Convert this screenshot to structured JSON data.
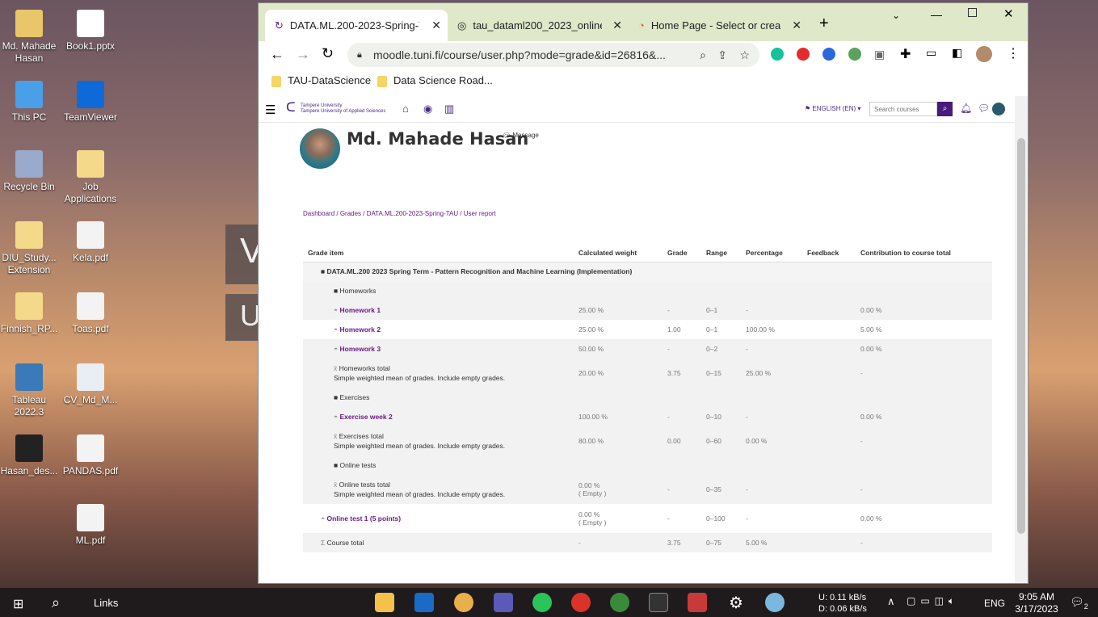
{
  "desktop_icons": [
    {
      "label": "Md. Mahade Hasan",
      "icon": "user-folder-icon"
    },
    {
      "label": "Book1.pptx",
      "icon": "pptx-icon"
    },
    {
      "label": "This PC",
      "icon": "pc-icon"
    },
    {
      "label": "TeamViewer",
      "icon": "teamviewer-icon"
    },
    {
      "label": "Recycle Bin",
      "icon": "recycle-icon"
    },
    {
      "label": "Job Applications",
      "icon": "folder-icon"
    },
    {
      "label": "DIU_Study... Extension",
      "icon": "folder-icon"
    },
    {
      "label": "Kela.pdf",
      "icon": "pdf-icon"
    },
    {
      "label": "Finnish_RP...",
      "icon": "folder-icon"
    },
    {
      "label": "Toas.pdf",
      "icon": "pdf-icon"
    },
    {
      "label": "Tableau 2022.3",
      "icon": "tableau-icon"
    },
    {
      "label": "CV_Md_M...",
      "icon": "doc-icon"
    },
    {
      "label": "Hasan_des...",
      "icon": "image-icon"
    },
    {
      "label": "PANDAS.pdf",
      "icon": "pdf-icon"
    },
    {
      "label": "ML.pdf",
      "icon": "pdf-icon"
    }
  ],
  "browser": {
    "tabs": [
      {
        "title": "DATA.ML.200-2023-Spring-TAU"
      },
      {
        "title": "tau_dataml200_2023_online1.g"
      },
      {
        "title": "Home Page - Select or create a"
      }
    ],
    "url": "moodle.tuni.fi/course/user.php?mode=grade&id=26816&...",
    "bookmarks": [
      "TAU-DataScience",
      "Data Science Road..."
    ]
  },
  "moodle": {
    "logo_line1": "Tampere University",
    "logo_line2": "Tampere University of Applied Sciences",
    "language": "ENGLISH (EN)",
    "search_placeholder": "Search courses",
    "user_name": "Md. Mahade Hasan",
    "message_label": "Message",
    "breadcrumb": [
      "Dashboard",
      "Grades",
      "DATA.ML.200-2023-Spring-TAU",
      "User report"
    ]
  },
  "grades": {
    "headers": [
      "Grade item",
      "Calculated weight",
      "Grade",
      "Range",
      "Percentage",
      "Feedback",
      "Contribution to course total"
    ],
    "course_category": "DATA.ML.200 2023 Spring Term - Pattern Recognition and Machine Learning (Implementation)",
    "rows": [
      {
        "kind": "category",
        "item": "Homeworks"
      },
      {
        "kind": "item",
        "item": "Homework 1",
        "weight": "25.00 %",
        "grade": "-",
        "range": "0–1",
        "pct": "-",
        "contrib": "0.00 %"
      },
      {
        "kind": "item",
        "item": "Homework 2",
        "weight": "25.00 %",
        "grade": "1.00",
        "range": "0–1",
        "pct": "100.00 %",
        "contrib": "5.00 %"
      },
      {
        "kind": "item",
        "item": "Homework 3",
        "weight": "50.00 %",
        "grade": "-",
        "range": "0–2",
        "pct": "-",
        "contrib": "0.00 %"
      },
      {
        "kind": "total",
        "item": "Homeworks total",
        "sub": "Simple weighted mean of grades. Include empty grades.",
        "weight": "20.00 %",
        "grade": "3.75",
        "range": "0–15",
        "pct": "25.00 %",
        "contrib": "-"
      },
      {
        "kind": "category",
        "item": "Exercises"
      },
      {
        "kind": "item",
        "item": "Exercise week 2",
        "weight": "100.00 %",
        "grade": "-",
        "range": "0–10",
        "pct": "-",
        "contrib": "0.00 %"
      },
      {
        "kind": "total",
        "item": "Exercises total",
        "sub": "Simple weighted mean of grades. Include empty grades.",
        "weight": "80.00 %",
        "grade": "0.00",
        "range": "0–60",
        "pct": "0.00 %",
        "contrib": "-"
      },
      {
        "kind": "category",
        "item": "Online tests"
      },
      {
        "kind": "total",
        "item": "Online tests total",
        "sub": "Simple weighted mean of grades. Include empty grades.",
        "weight": "0.00 %",
        "weight2": "( Empty )",
        "grade": "-",
        "range": "0–35",
        "pct": "-",
        "contrib": "-"
      },
      {
        "kind": "item0",
        "item": "Online test 1 (5 points)",
        "weight": "0.00 %",
        "weight2": "( Empty )",
        "grade": "-",
        "range": "0–100",
        "pct": "-",
        "contrib": "0.00 %"
      },
      {
        "kind": "course",
        "item": "Course total",
        "weight": "-",
        "grade": "3.75",
        "range": "0–75",
        "pct": "5.00 %",
        "contrib": "-"
      }
    ]
  },
  "taskbar": {
    "links_label": "Links",
    "net_up": "U:   0.11 kB/s",
    "net_down": "D:   0.06 kB/s",
    "lang": "ENG",
    "time": "9:05 AM",
    "date": "3/17/2023",
    "notif": "2"
  }
}
